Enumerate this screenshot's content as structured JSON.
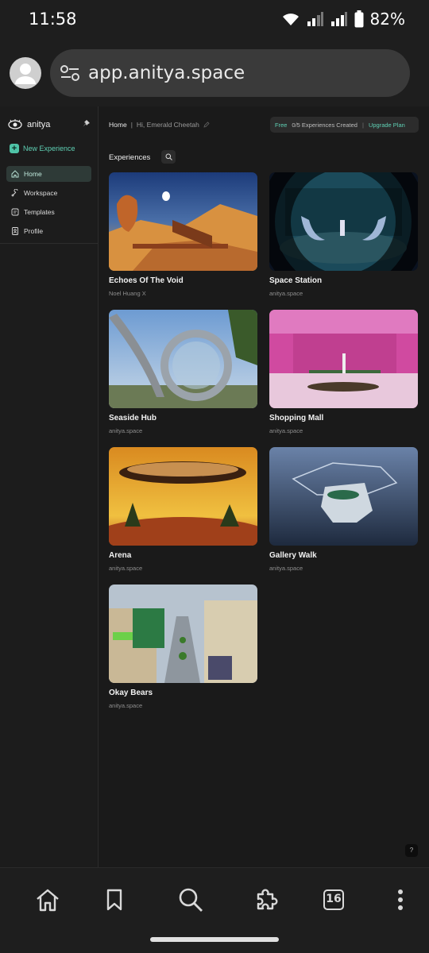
{
  "status": {
    "time": "11:58",
    "battery": "82%"
  },
  "browser": {
    "url": "app.anitya.space",
    "tab_count": "16"
  },
  "sidebar": {
    "brand": "anitya",
    "new_experience": "New Experience",
    "items": [
      {
        "label": "Home",
        "icon": "home-icon",
        "active": true
      },
      {
        "label": "Workspace",
        "icon": "wrench-icon",
        "active": false
      },
      {
        "label": "Templates",
        "icon": "templates-icon",
        "active": false
      },
      {
        "label": "Profile",
        "icon": "profile-icon",
        "active": false
      }
    ]
  },
  "header": {
    "breadcrumb": "Home",
    "greeting": "Hi, Emerald Cheetah",
    "plan": "Free",
    "usage": "0/5 Experiences Created",
    "upgrade": "Upgrade Plan"
  },
  "section_title": "Experiences",
  "experiences": [
    {
      "title": "Echoes Of The Void",
      "author": "Noel Huang X"
    },
    {
      "title": "Space Station",
      "author": "anitya.space"
    },
    {
      "title": "Seaside Hub",
      "author": "anitya.space"
    },
    {
      "title": "Shopping Mall",
      "author": "anitya.space"
    },
    {
      "title": "Arena",
      "author": "anitya.space"
    },
    {
      "title": "Gallery Walk",
      "author": "anitya.space"
    },
    {
      "title": "Okay Bears",
      "author": "anitya.space"
    }
  ],
  "help": "?",
  "colors": {
    "accent": "#5fd0b4",
    "background": "#1a1a1a"
  }
}
